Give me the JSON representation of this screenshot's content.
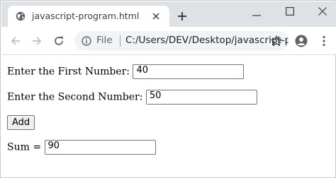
{
  "browser": {
    "tab_title": "javascript-program.html",
    "omnibox_scheme": "File",
    "omnibox_url": "C:/Users/DEV/Desktop/javascript-program.html"
  },
  "form": {
    "first_label": "Enter the First Number:",
    "first_value": "40",
    "second_label": "Enter the Second Number:",
    "second_value": "50",
    "add_label": "Add",
    "sum_label": "Sum =",
    "sum_value": "90"
  }
}
